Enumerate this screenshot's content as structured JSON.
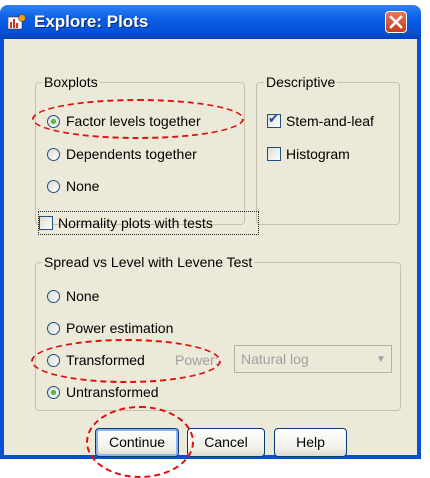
{
  "window": {
    "title": "Explore: Plots"
  },
  "boxplots": {
    "legend": "Boxplots",
    "options": [
      "Factor levels together",
      "Dependents together",
      "None"
    ],
    "selected": "Factor levels together"
  },
  "descriptive": {
    "legend": "Descriptive",
    "options": [
      {
        "label": "Stem-and-leaf",
        "checked": true
      },
      {
        "label": "Histogram",
        "checked": false
      }
    ]
  },
  "normality": {
    "label": "Normality plots with tests",
    "checked": false
  },
  "spread": {
    "legend": "Spread vs Level with Levene Test",
    "options": [
      "None",
      "Power estimation",
      "Transformed",
      "Untransformed"
    ],
    "selected": "Untransformed",
    "power_label": "Power:",
    "power_value": "Natural log"
  },
  "buttons": {
    "continue": "Continue",
    "cancel": "Cancel",
    "help": "Help"
  },
  "colors": {
    "title_bar": "#0a5fe6",
    "dialog_bg": "#ece9d8",
    "annotation": "#e01010"
  }
}
